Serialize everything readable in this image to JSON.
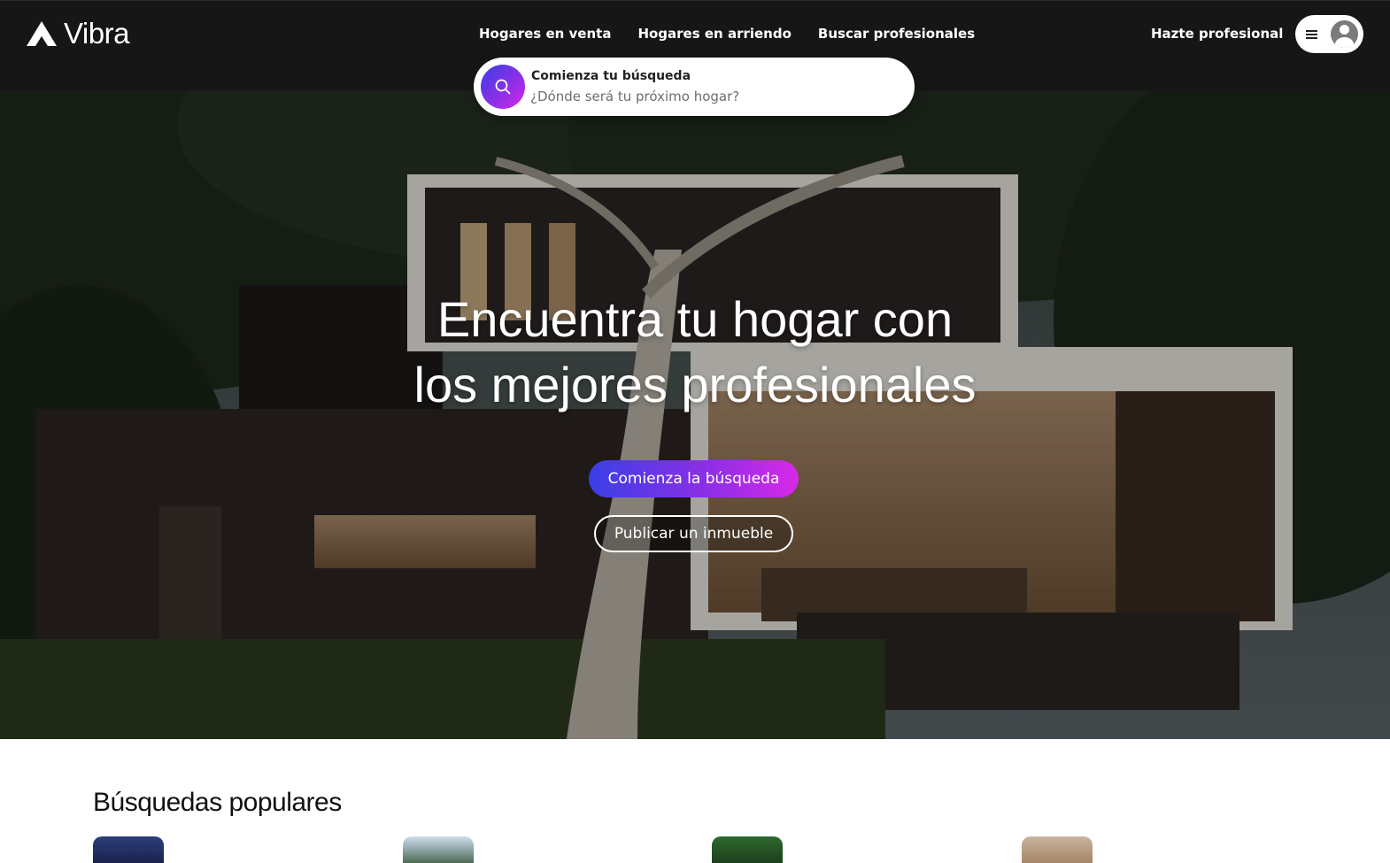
{
  "header": {
    "logo_text": "Vibra",
    "nav": [
      {
        "label": "Hogares en venta"
      },
      {
        "label": "Hogares en arriendo"
      },
      {
        "label": "Buscar profesionales"
      }
    ],
    "become_pro_label": "Hazte profesional",
    "menu_icon": "hamburger-icon",
    "avatar_icon": "user-avatar-icon"
  },
  "search": {
    "title": "Comienza tu búsqueda",
    "placeholder": "¿Dónde será tu próximo hogar?",
    "value": "",
    "icon": "search-icon"
  },
  "hero": {
    "title_line1": "Encuentra tu hogar con",
    "title_line2": "los mejores profesionales",
    "primary_button": "Comienza la búsqueda",
    "secondary_button": "Publicar un inmueble"
  },
  "popular": {
    "title": "Búsquedas populares"
  },
  "colors": {
    "header_bg": "#161616",
    "gradient_start": "#3a3fe6",
    "gradient_mid": "#8a2fe6",
    "gradient_end": "#d729e6"
  }
}
